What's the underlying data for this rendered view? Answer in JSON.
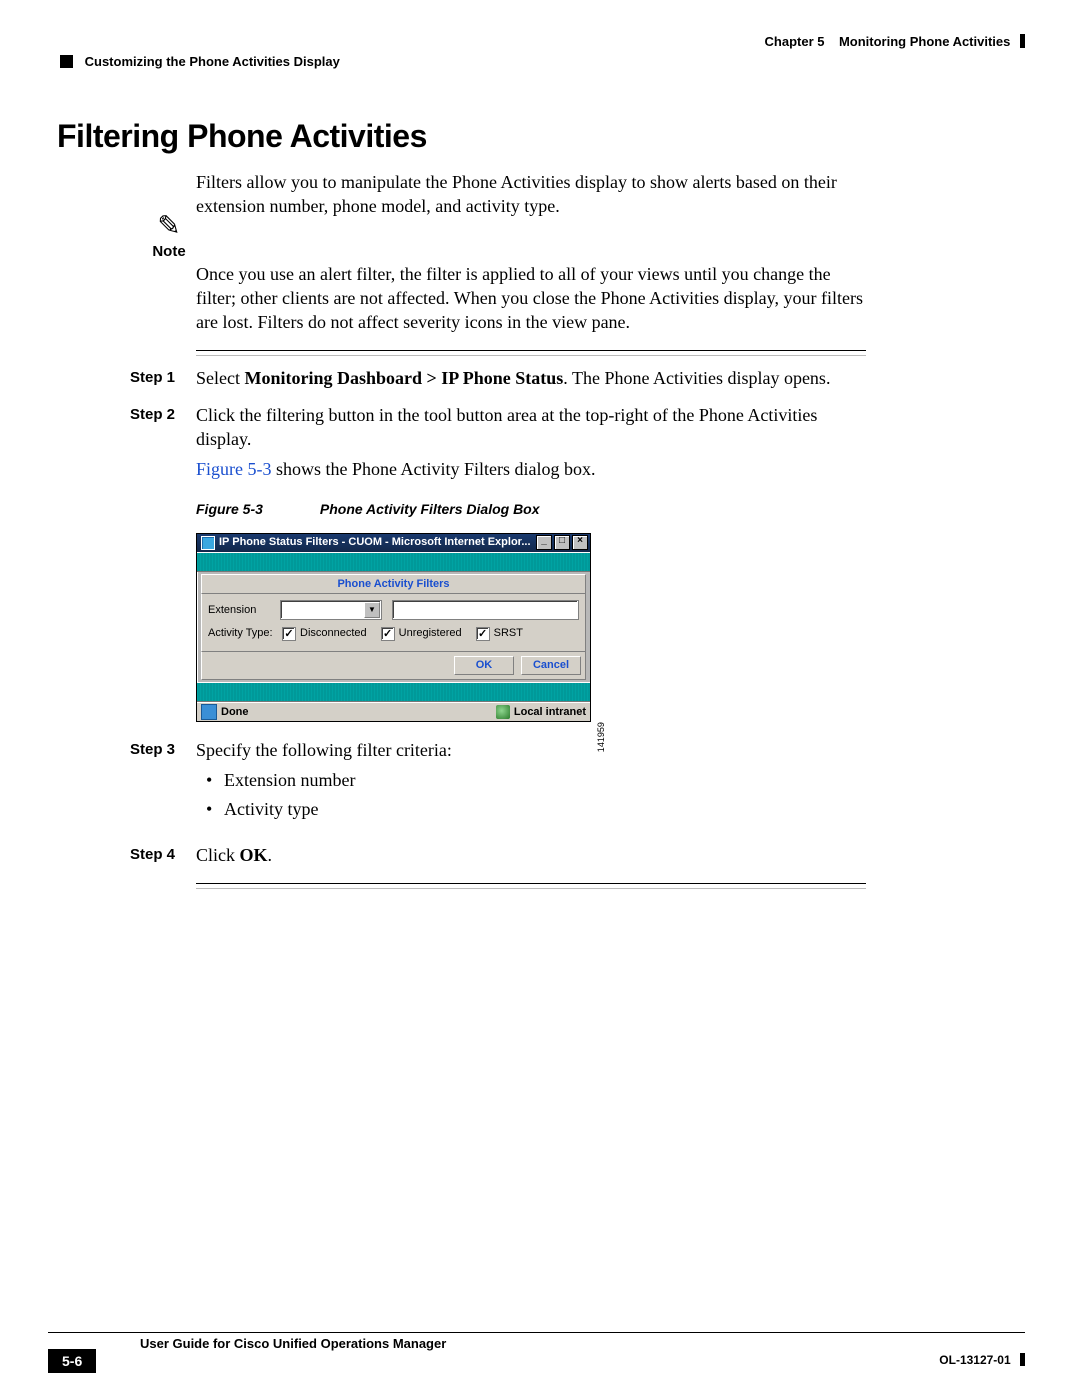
{
  "header": {
    "chapter": "Chapter 5",
    "chapter_title": "Monitoring Phone Activities",
    "section": "Customizing the Phone Activities Display"
  },
  "title": "Filtering Phone Activities",
  "intro": "Filters allow you to manipulate the Phone Activities display to show alerts based on their extension number, phone model, and activity type.",
  "note": {
    "label": "Note",
    "text": "Once you use an alert filter, the filter is applied to all of your views until you change the filter; other clients are not affected. When you close the Phone Activities display, your filters are lost. Filters do not affect severity icons in the view pane."
  },
  "steps": {
    "s1": {
      "label": "Step 1",
      "pre": "Select ",
      "bold": "Monitoring Dashboard > IP Phone Status",
      "post": ". The Phone Activities display opens."
    },
    "s2": {
      "label": "Step 2",
      "line1": "Click the filtering button in the tool button area at the top-right of the Phone Activities display.",
      "figref": "Figure 5-3",
      "line2_rest": " shows the Phone Activity Filters dialog box."
    },
    "s3": {
      "label": "Step 3",
      "lead": "Specify the following filter criteria:",
      "criteria": [
        "Extension number",
        "Activity type"
      ]
    },
    "s4": {
      "label": "Step 4",
      "pre": "Click ",
      "bold": "OK",
      "post": "."
    }
  },
  "figure": {
    "num": "Figure 5-3",
    "caption": "Phone Activity Filters Dialog Box",
    "watermark": "141959"
  },
  "dialog": {
    "title": "IP Phone Status Filters - CUOM - Microsoft Internet Explor...",
    "header": "Phone Activity Filters",
    "extension_label": "Extension",
    "activity_label": "Activity Type:",
    "chk_disconnected": "Disconnected",
    "chk_unregistered": "Unregistered",
    "chk_srst": "SRST",
    "ok": "OK",
    "cancel": "Cancel",
    "status_done": "Done",
    "status_zone": "Local intranet"
  },
  "footer": {
    "guide": "User Guide for Cisco Unified Operations Manager",
    "page": "5-6",
    "docnum": "OL-13127-01"
  }
}
